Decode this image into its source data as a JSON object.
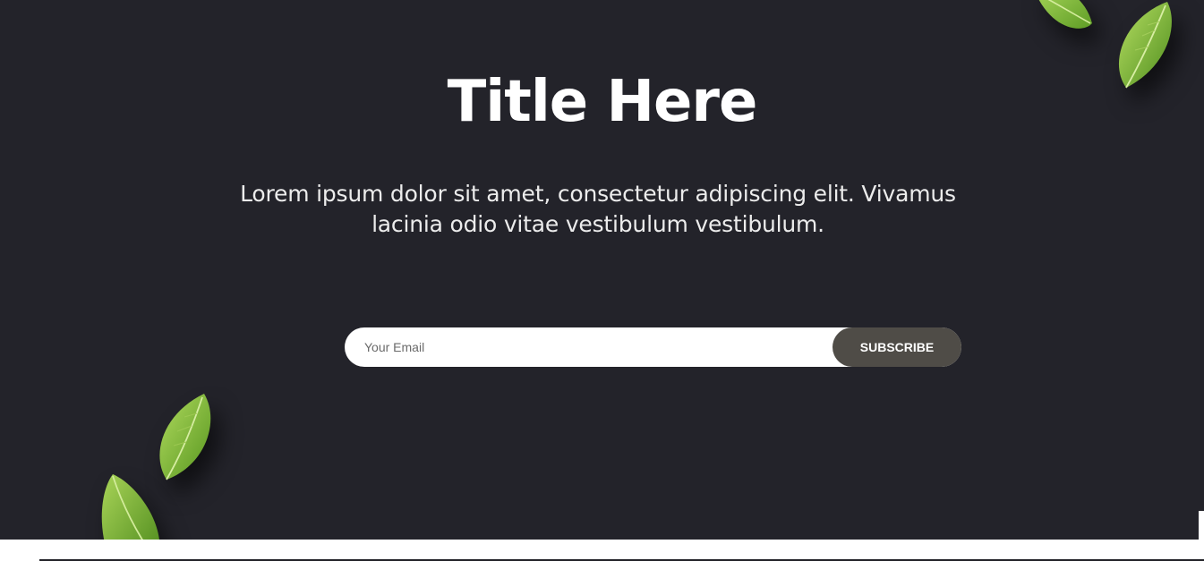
{
  "hero": {
    "title": "Title Here",
    "subtitle": "Lorem ipsum dolor sit amet, consectetur adipiscing elit. Vivamus lacinia odio vitae vestibulum vestibulum.",
    "background_color": "#23232a"
  },
  "subscribe": {
    "email_placeholder": "Your Email",
    "email_value": "",
    "button_label": "SUBSCRIBE",
    "button_color": "#4f4c47"
  },
  "decorations": {
    "leaf_icon": "basil-leaf-icon",
    "leaf_color": "#7bb83a"
  }
}
